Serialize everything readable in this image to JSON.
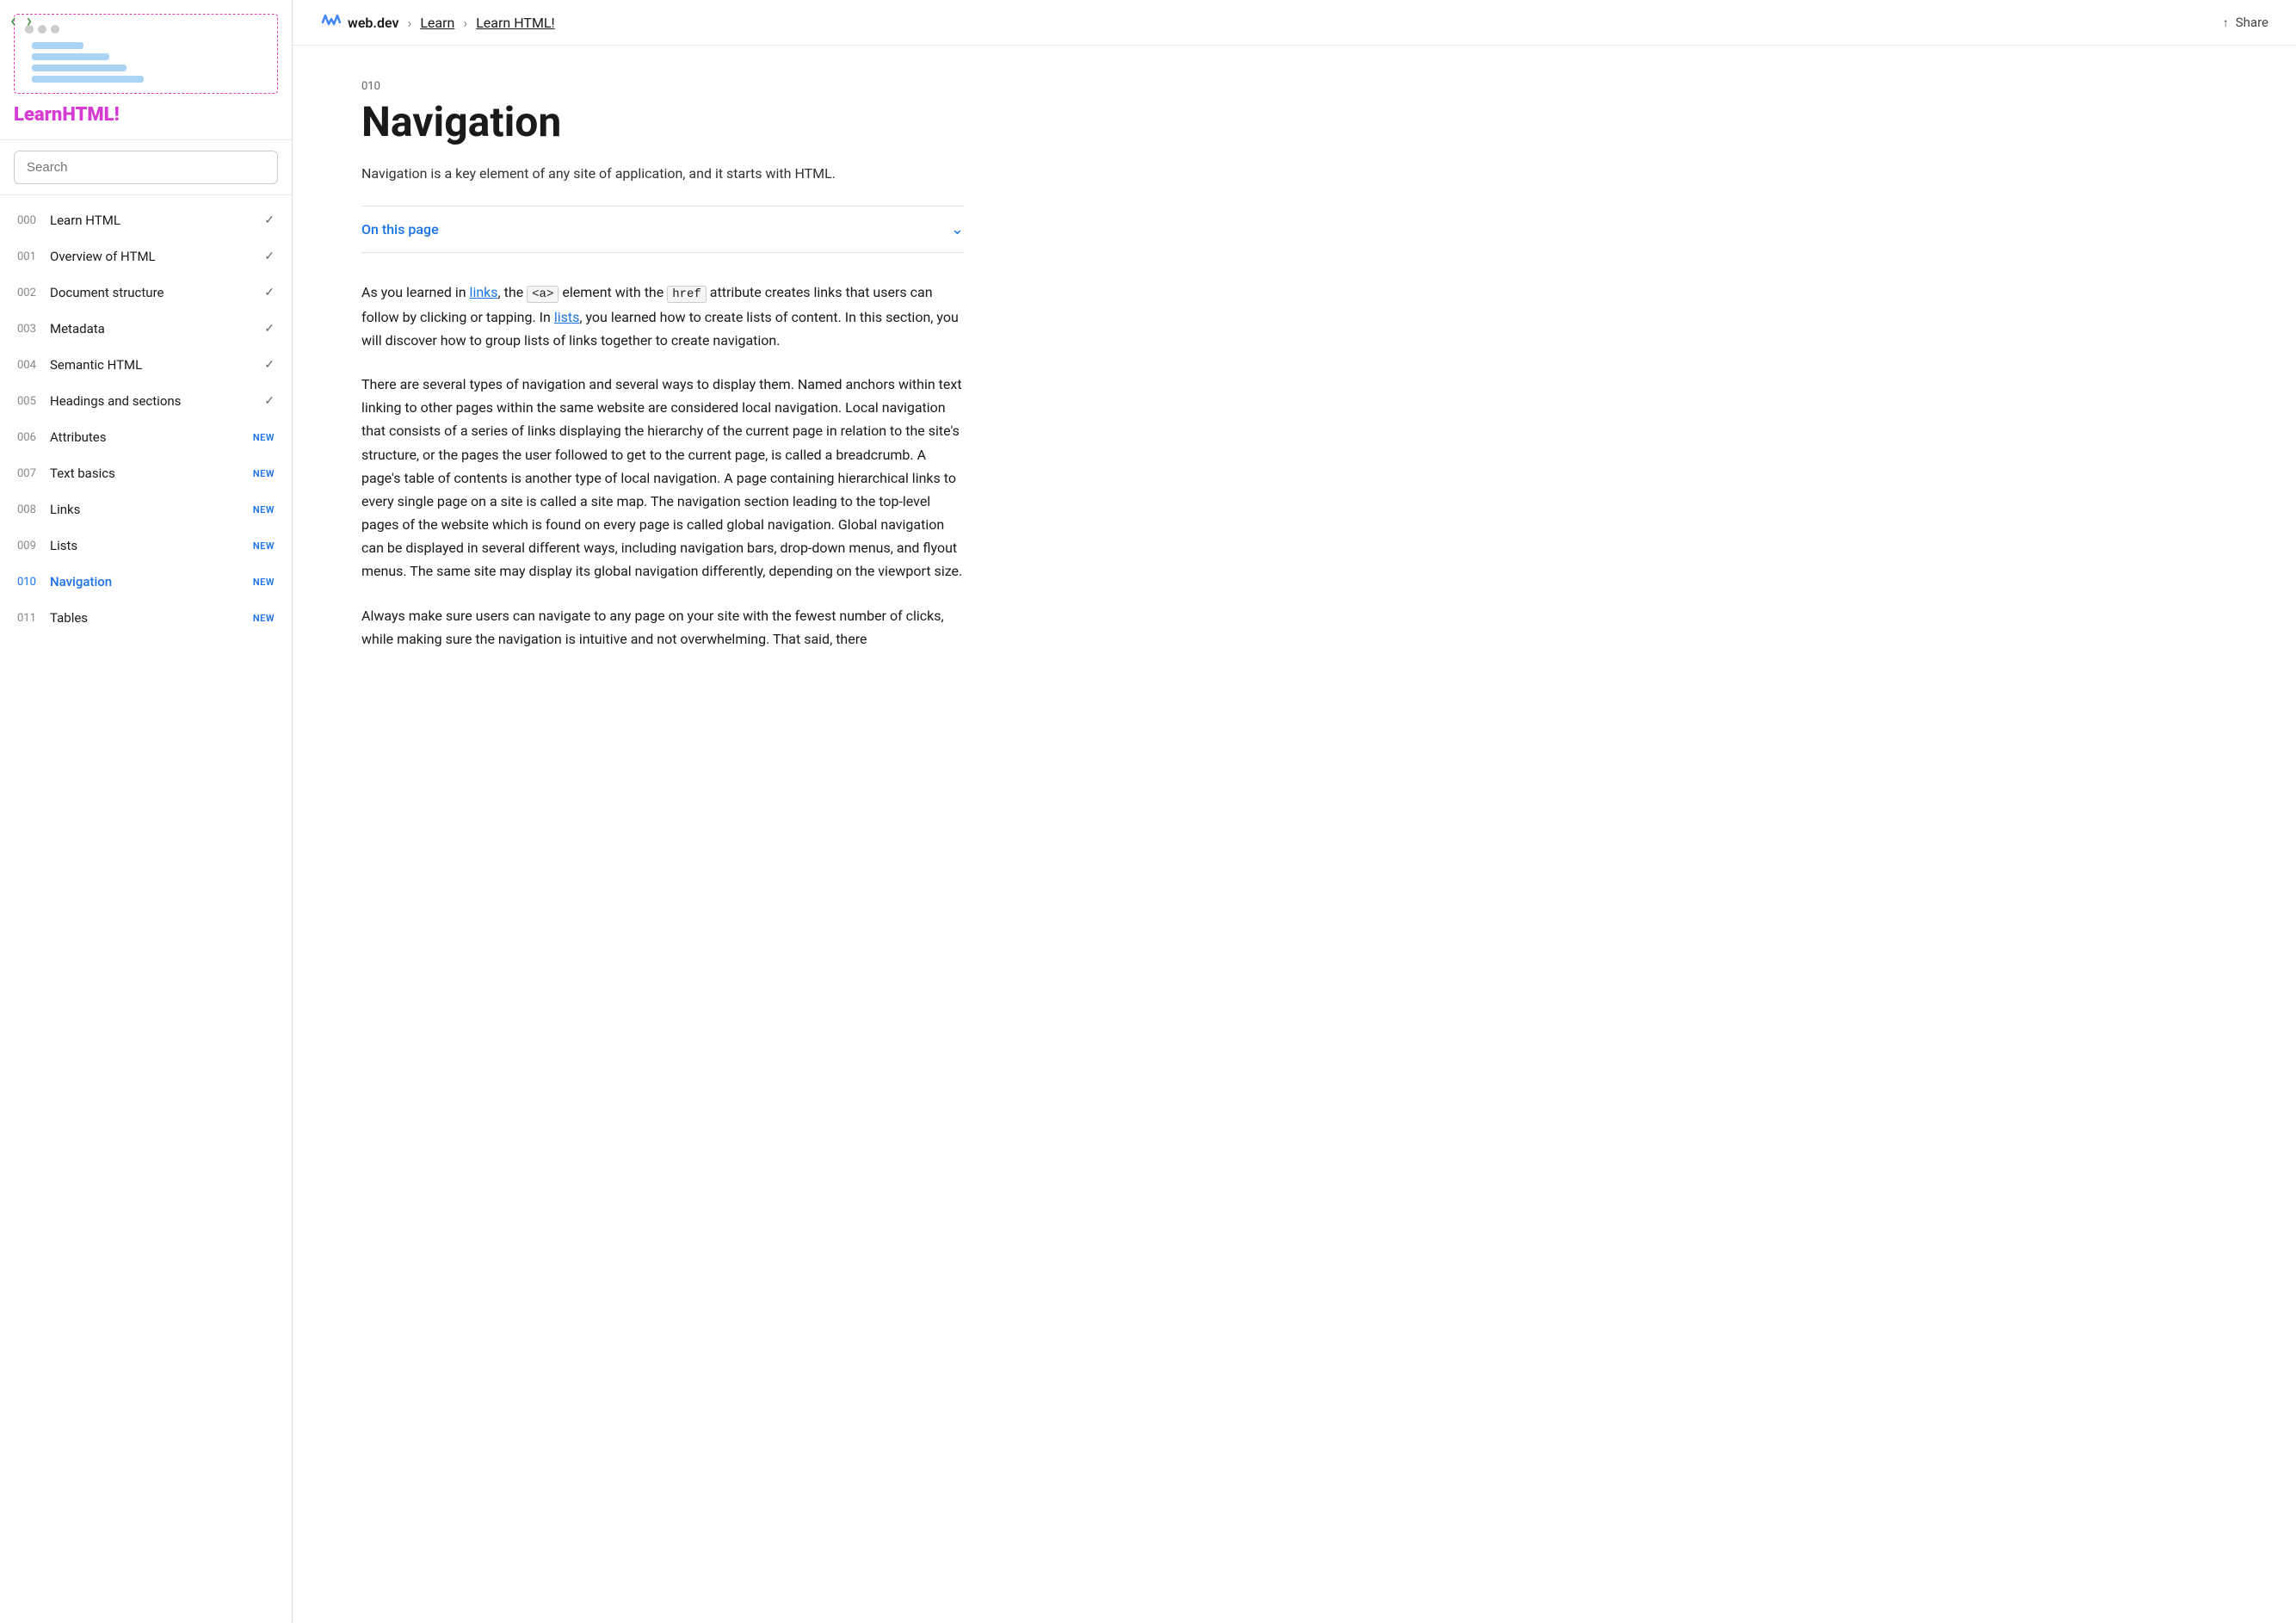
{
  "sidebar": {
    "logo_learn": "Learn",
    "logo_html": "HTML!",
    "search_placeholder": "Search",
    "nav_items": [
      {
        "number": "000",
        "label": "Learn HTML",
        "badge": "",
        "check": true,
        "active": false
      },
      {
        "number": "001",
        "label": "Overview of HTML",
        "badge": "",
        "check": true,
        "active": false
      },
      {
        "number": "002",
        "label": "Document structure",
        "badge": "",
        "check": true,
        "active": false
      },
      {
        "number": "003",
        "label": "Metadata",
        "badge": "",
        "check": true,
        "active": false
      },
      {
        "number": "004",
        "label": "Semantic HTML",
        "badge": "",
        "check": true,
        "active": false
      },
      {
        "number": "005",
        "label": "Headings and sections",
        "badge": "",
        "check": true,
        "active": false
      },
      {
        "number": "006",
        "label": "Attributes",
        "badge": "NEW",
        "check": false,
        "active": false
      },
      {
        "number": "007",
        "label": "Text basics",
        "badge": "NEW",
        "check": false,
        "active": false
      },
      {
        "number": "008",
        "label": "Links",
        "badge": "NEW",
        "check": false,
        "active": false
      },
      {
        "number": "009",
        "label": "Lists",
        "badge": "NEW",
        "check": false,
        "active": false
      },
      {
        "number": "010",
        "label": "Navigation",
        "badge": "NEW",
        "check": false,
        "active": true
      },
      {
        "number": "011",
        "label": "Tables",
        "badge": "NEW",
        "check": false,
        "active": false
      }
    ]
  },
  "topnav": {
    "site_name": "web.dev",
    "breadcrumb_learn": "Learn",
    "breadcrumb_current": "Learn HTML!",
    "share_label": "Share"
  },
  "main": {
    "lesson_number": "010",
    "page_title": "Navigation",
    "subtitle": "Navigation is a key element of any site of application, and it starts with HTML.",
    "on_this_page": "On this page",
    "paragraphs": [
      "As you learned in links, the <a> element with the href attribute creates links that users can follow by clicking or tapping. In lists, you learned how to create lists of content. In this section, you will discover how to group lists of links together to create navigation.",
      "There are several types of navigation and several ways to display them. Named anchors within text linking to other pages within the same website are considered local navigation. Local navigation that consists of a series of links displaying the hierarchy of the current page in relation to the site's structure, or the pages the user followed to get to the current page, is called a breadcrumb. A page's table of contents is another type of local navigation. A page containing hierarchical links to every single page on a site is called a site map. The navigation section leading to the top-level pages of the website which is found on every page is called global navigation. Global navigation can be displayed in several different ways, including navigation bars, drop-down menus, and flyout menus. The same site may display its global navigation differently, depending on the viewport size.",
      "Always make sure users can navigate to any page on your site with the fewest number of clicks, while making sure the navigation is intuitive and not overwhelming. That said, there"
    ]
  },
  "icons": {
    "arrow_left": "‹",
    "arrow_right": "›",
    "share": "⬆",
    "chevron_down": "⌄",
    "check": "✓"
  }
}
